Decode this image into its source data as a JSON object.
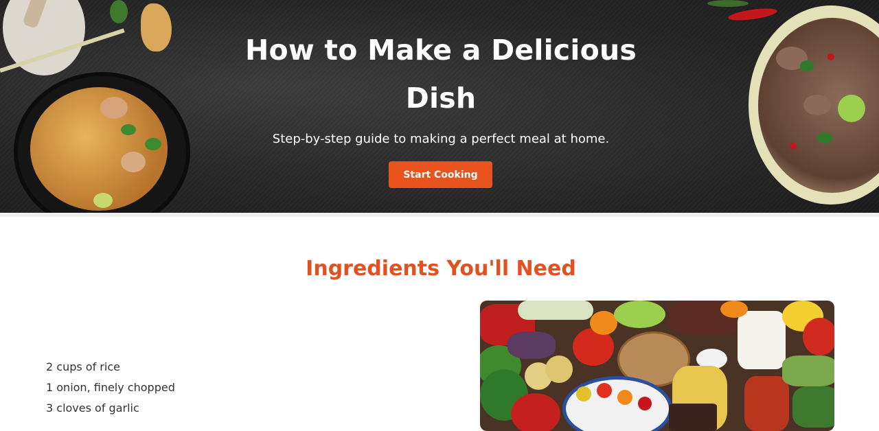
{
  "hero": {
    "title": "How to Make a Delicious Dish",
    "subtitle": "Step-by-step guide to making a perfect meal at home.",
    "cta_label": "Start Cooking"
  },
  "ingredients": {
    "title": "Ingredients You'll Need",
    "items": [
      "2 cups of rice",
      "1 onion, finely chopped",
      "3 cloves of garlic"
    ]
  },
  "colors": {
    "accent": "#e8531e",
    "section_title": "#e2511f",
    "hero_background": "#262626"
  }
}
